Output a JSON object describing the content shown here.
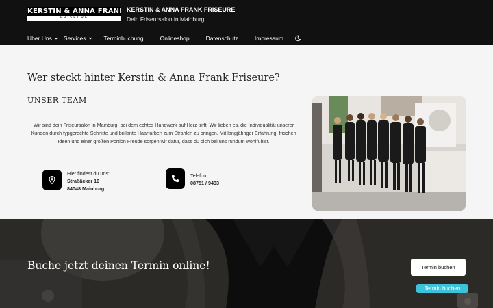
{
  "header": {
    "logo": {
      "line1": "KERSTIN & ANNA FRANK",
      "line2": "FRISEURE"
    },
    "site_title": "KERSTIN & ANNA FRANK FRISEURE",
    "tagline": "Dein Friseursalon in Mainburg",
    "nav": [
      {
        "label": "Über Uns",
        "has_dropdown": true
      },
      {
        "label": "Services",
        "has_dropdown": true
      },
      {
        "label": "Terminbuchung",
        "has_dropdown": false
      },
      {
        "label": "Onlineshop",
        "has_dropdown": false
      },
      {
        "label": "Datenschutz",
        "has_dropdown": false
      },
      {
        "label": "Impressum",
        "has_dropdown": false
      }
    ],
    "theme_icon": "moon-icon"
  },
  "main": {
    "heading": "Wer steckt hinter Kerstin & Anna Frank Friseure?",
    "subheading": "UNSER TEAM",
    "intro": "Wir sind dein Friseursalon in Mainburg, bei dem echtes Handwerk auf Herz trifft. Wir lieben es, die Individualität unserer Kunden durch typgerechte Schnitte und brillante Haarfarben zum Strahlen zu bringen. Mit langjähriger Erfahrung, frischen Ideen und einer großen Portion Freude sorgen wir dafür, dass du dich bei uns rundum wohlfühlst.",
    "address": {
      "label": "Hier findest du uns:",
      "street": "Straßäcker 10",
      "city": "84048 Mainburg",
      "icon": "location-pin-icon"
    },
    "phone": {
      "label": "Telefon:",
      "number": "08751 / 9433",
      "icon": "phone-icon"
    }
  },
  "banner": {
    "text": "Buche jetzt deinen Termin online!",
    "button": "Termin buchen"
  },
  "floating_button": "Termin buchen",
  "colors": {
    "header_bg": "#111111",
    "accent": "#3cc3d9",
    "banner_bg": "#2e2d2b"
  }
}
